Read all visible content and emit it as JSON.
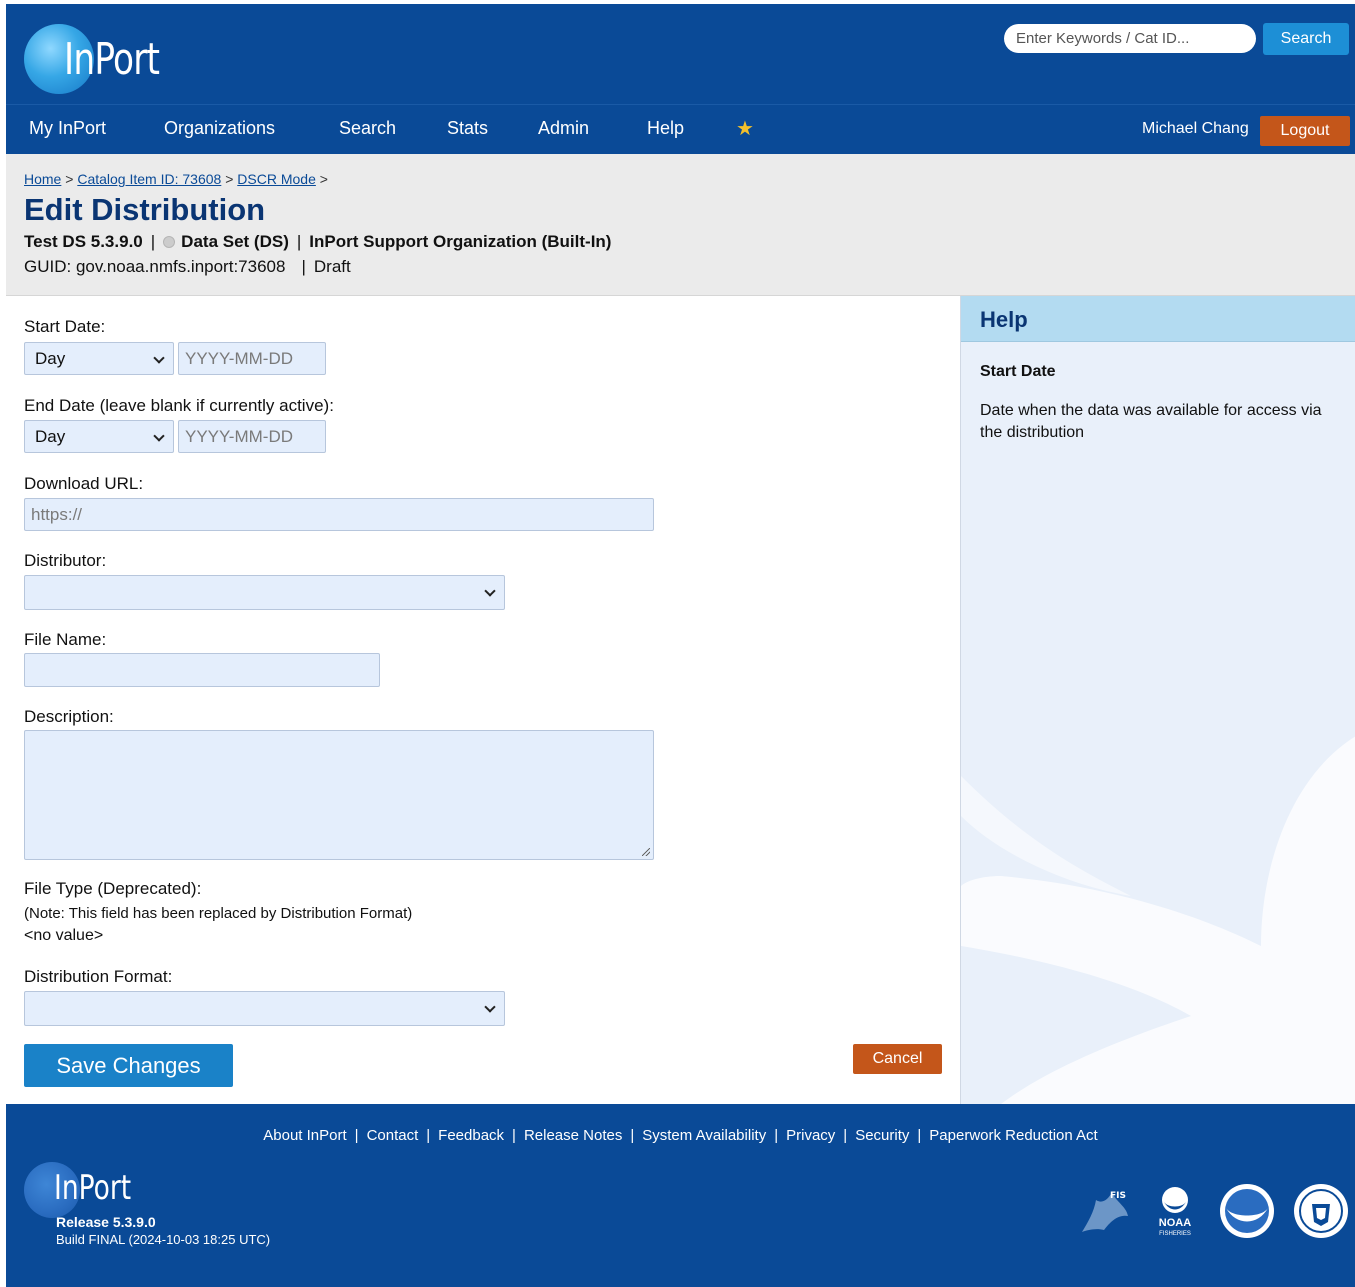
{
  "header": {
    "logo_text": "InPort",
    "search_placeholder": "Enter Keywords / Cat ID...",
    "search_button": "Search"
  },
  "nav": {
    "items": [
      "My InPort",
      "Organizations",
      "Search",
      "Stats",
      "Admin",
      "Help"
    ],
    "favorites_icon": "star-icon",
    "user_name": "Michael Chang",
    "logout_label": "Logout"
  },
  "breadcrumb": {
    "home": "Home",
    "sep": ">",
    "catalog": "Catalog Item ID: 73608",
    "mode": "DSCR Mode"
  },
  "page": {
    "title": "Edit Distribution",
    "item_name": "Test DS 5.3.9.0",
    "item_type": "Data Set (DS)",
    "organization": "InPort Support Organization (Built-In)",
    "guid": "GUID: gov.noaa.nmfs.inport:73608",
    "status": "Draft",
    "divider": "|"
  },
  "form": {
    "start_date_label": "Start Date:",
    "start_date_unit": "Day",
    "start_date_placeholder": "YYYY-MM-DD",
    "end_date_label": "End Date (leave blank if currently active):",
    "end_date_unit": "Day",
    "end_date_placeholder": "YYYY-MM-DD",
    "download_url_label": "Download URL:",
    "download_url_placeholder": "https://",
    "distributor_label": "Distributor:",
    "file_name_label": "File Name:",
    "description_label": "Description:",
    "file_type_label": "File Type (Deprecated):",
    "file_type_note": "(Note: This field has been replaced by Distribution Format)",
    "file_type_value": "<no value>",
    "distribution_format_label": "Distribution Format:",
    "save_label": "Save Changes",
    "cancel_label": "Cancel"
  },
  "help": {
    "title": "Help",
    "subtitle": "Start Date",
    "text": "Date when the data was available for access via the distribution"
  },
  "footer": {
    "links": [
      "About InPort",
      "Contact",
      "Feedback",
      "Release Notes",
      "System Availability",
      "Privacy",
      "Security",
      "Paperwork Reduction Act"
    ],
    "link_separator": "|",
    "logo_text": "InPort",
    "release": "Release 5.3.9.0",
    "build": "Build FINAL (2024-10-03 18:25 UTC)",
    "agency_logos": [
      "fis-logo-icon",
      "noaa-fisheries-logo-icon",
      "noaa-logo-icon",
      "commerce-seal-icon"
    ],
    "fis_text": "FIS",
    "noaa_text": "NOAA",
    "fisheries_text": "FISHERIES"
  },
  "colors": {
    "header_blue": "#0a4a97",
    "accent_blue": "#1a82c8",
    "orange": "#c4561a",
    "help_header": "#b3dbf1",
    "field_bg": "#e4eefc"
  }
}
